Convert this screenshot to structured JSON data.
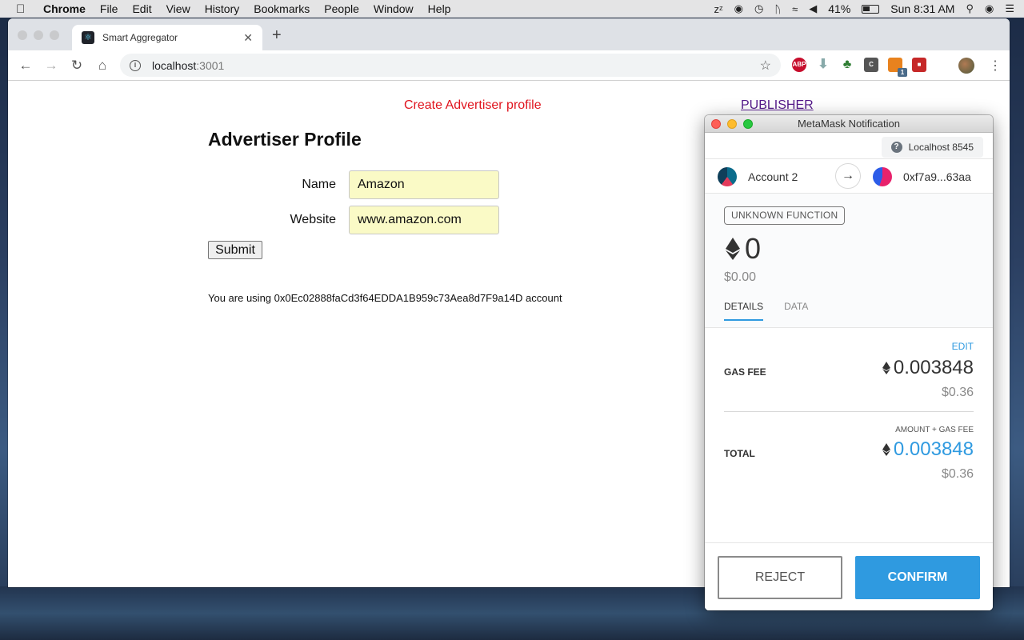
{
  "menubar": {
    "app": "Chrome",
    "items": [
      "File",
      "Edit",
      "View",
      "History",
      "Bookmarks",
      "People",
      "Window",
      "Help"
    ],
    "battery": "41%",
    "clock": "Sun 8:31 AM"
  },
  "browser": {
    "tab_title": "Smart Aggregator",
    "url_host": "localhost",
    "url_port": ":3001",
    "ext_badge": "1"
  },
  "page": {
    "nav_create": "Create Advertiser profile",
    "nav_publisher": "PUBLISHER",
    "title": "Advertiser Profile",
    "name_label": "Name",
    "name_value": "Amazon",
    "website_label": "Website",
    "website_value": "www.amazon.com",
    "submit_label": "Submit",
    "account_note": "You are using 0x0Ec02888faCd3f64EDDA1B959c73Aea8d7F9a14D account"
  },
  "metamask": {
    "window_title": "MetaMask Notification",
    "network": "Localhost 8545",
    "from_account": "Account 2",
    "to_address": "0xf7a9...63aa",
    "function_badge": "UNKNOWN FUNCTION",
    "amount_eth": "0",
    "amount_fiat": "$0.00",
    "tabs": [
      "DETAILS",
      "DATA"
    ],
    "edit_label": "EDIT",
    "gas_fee_label": "GAS FEE",
    "gas_fee_eth": "0.003848",
    "gas_fee_fiat": "$0.36",
    "sum_label": "AMOUNT + GAS FEE",
    "total_label": "TOTAL",
    "total_eth": "0.003848",
    "total_fiat": "$0.36",
    "reject_label": "REJECT",
    "confirm_label": "CONFIRM",
    "accent_color": "#2f9ae0"
  }
}
